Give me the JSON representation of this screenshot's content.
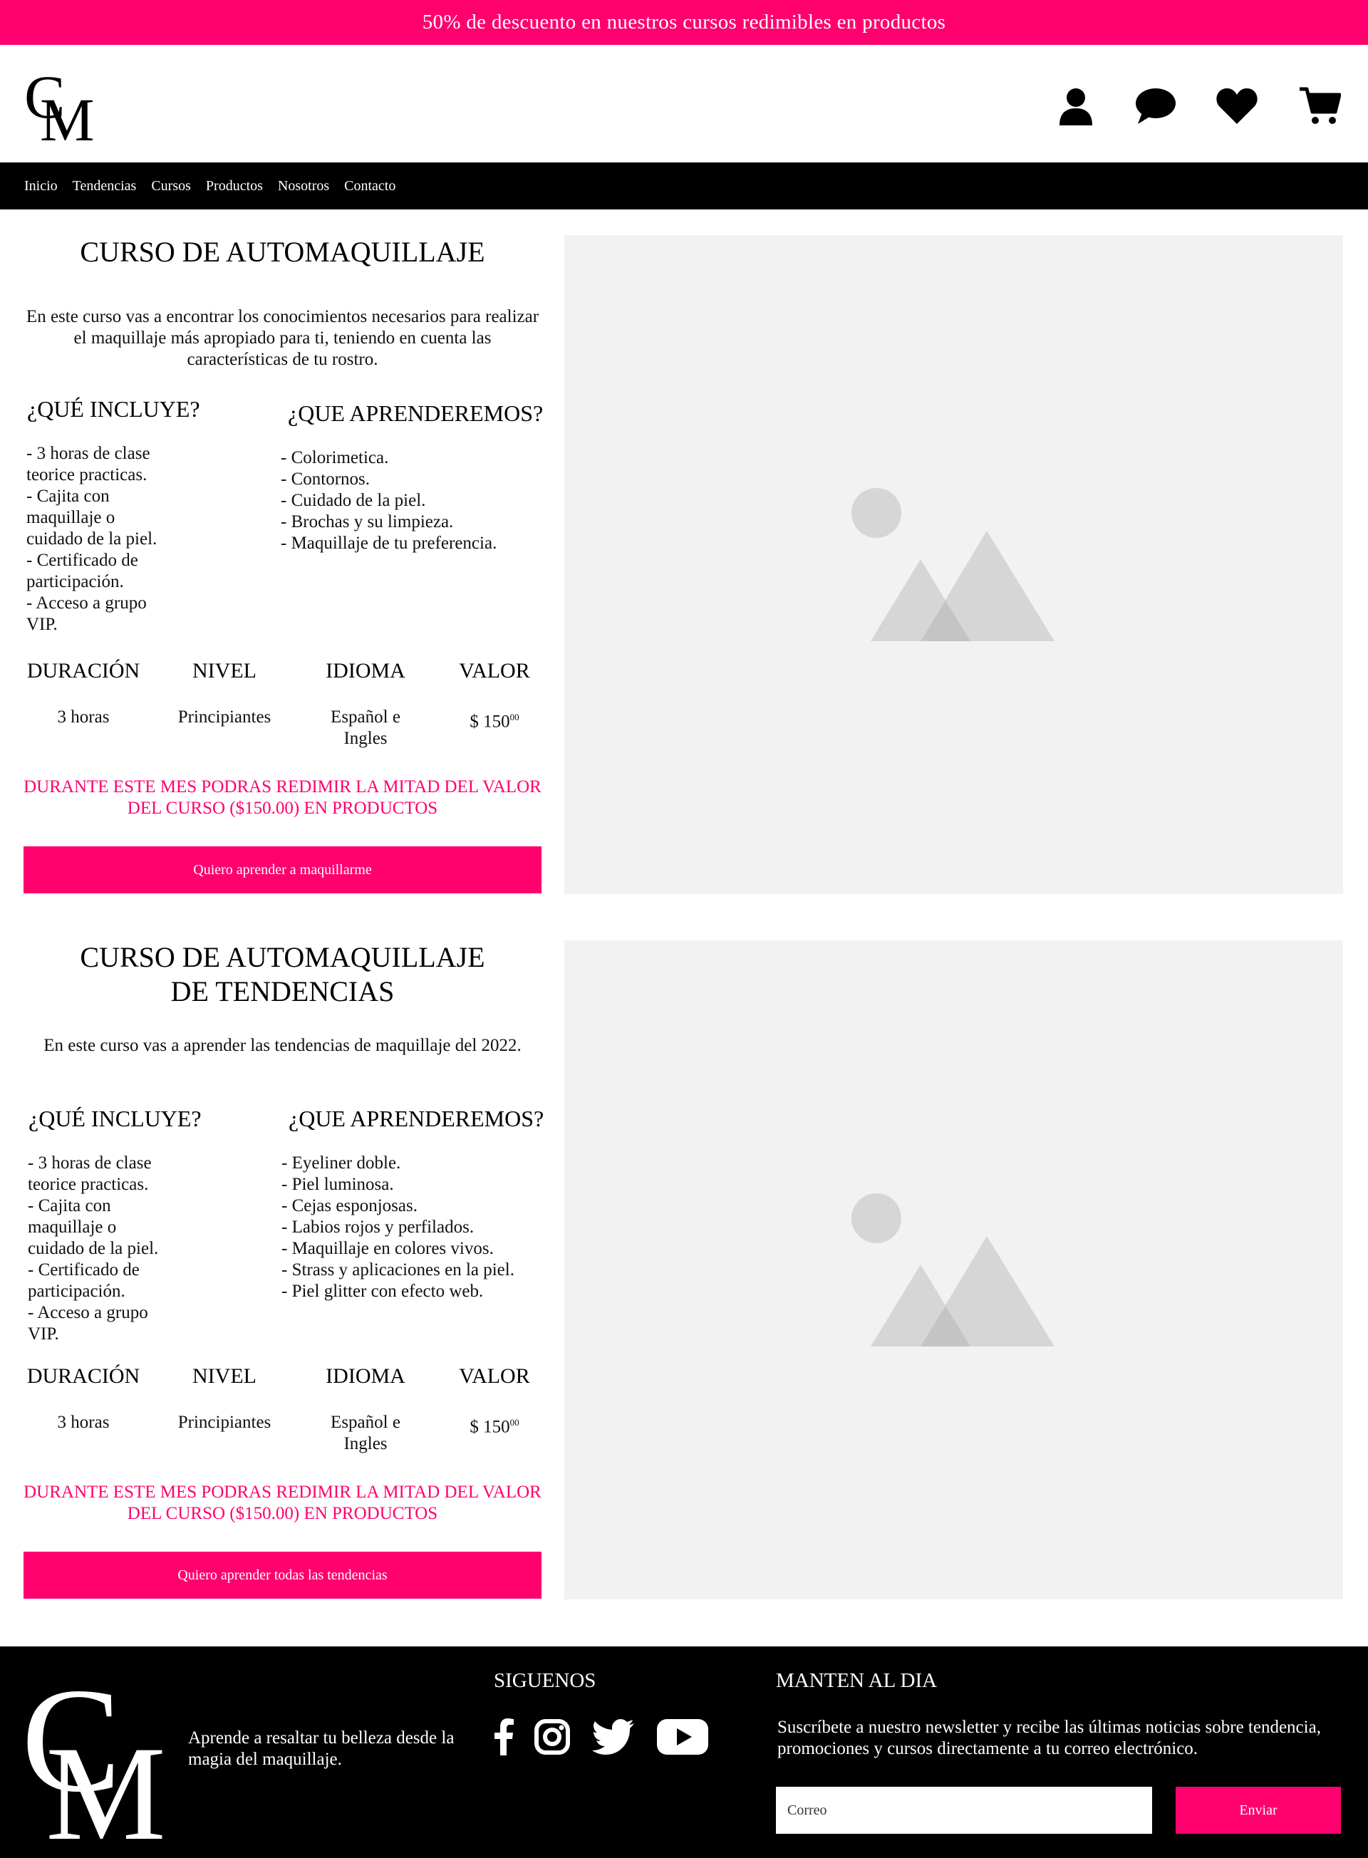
{
  "promo_bar": {
    "text": "50% de descuento en nuestros cursos redimibles en productos"
  },
  "nav": {
    "items": [
      "Inicio",
      "Tendencias",
      "Cursos",
      "Productos",
      "Nosotros",
      "Contacto"
    ]
  },
  "header_icons": [
    "user-icon",
    "chat-icon",
    "heart-icon",
    "cart-icon"
  ],
  "courses": [
    {
      "title": "CURSO DE AUTOMAQUILLAJE",
      "description": "En este curso vas a encontrar los conocimientos necesarios para realizar el maquillaje más apropiado para ti, teniendo en cuenta las características de tu rostro.",
      "includes_heading": "¿QUÉ INCLUYE?",
      "includes": [
        "- 3 horas de clase\nteorice practicas.",
        "- Cajita con\nmaquillaje o\ncuidado de la piel.",
        "- Certificado de\nparticipación.",
        "- Acceso a grupo\nVIP."
      ],
      "learn_heading": "¿QUE APRENDEREMOS?",
      "learn": [
        "- Colorimetica.",
        "- Contornos.",
        "- Cuidado de la piel.",
        "- Brochas y su limpieza.",
        "- Maquillaje de tu preferencia."
      ],
      "stats": {
        "duration_label": "DURACIÓN",
        "duration": "3 horas",
        "level_label": "NIVEL",
        "level": "Principiantes",
        "language_label": "IDIOMA",
        "language": "Español e Ingles",
        "price_label": "VALOR",
        "price": "$ 150",
        "price_cents": "00"
      },
      "promo_note": "DURANTE ESTE MES PODRAS REDIMIR LA MITAD DEL VALOR DEL CURSO ($150.00) EN PRODUCTOS",
      "cta": "Quiero aprender a maquillarme"
    },
    {
      "title": "CURSO DE AUTOMAQUILLAJE DE TENDENCIAS",
      "description": "En este curso vas a aprender las tendencias de maquillaje del 2022.",
      "includes_heading": "¿QUÉ INCLUYE?",
      "includes": [
        "- 3 horas de clase\nteorice practicas.",
        "- Cajita con\nmaquillaje o\ncuidado de la piel.",
        "- Certificado de\nparticipación.",
        "- Acceso a grupo\nVIP."
      ],
      "learn_heading": "¿QUE APRENDEREMOS?",
      "learn": [
        "- Eyeliner doble.",
        "- Piel luminosa.",
        "- Cejas esponjosas.",
        "- Labios rojos y perfilados.",
        "- Maquillaje en colores vivos.",
        "- Strass y aplicaciones en la piel.",
        "- Piel glitter con efecto web."
      ],
      "stats": {
        "duration_label": "DURACIÓN",
        "duration": "3 horas",
        "level_label": "NIVEL",
        "level": "Principiantes",
        "language_label": "IDIOMA",
        "language": "Español e Ingles",
        "price_label": "VALOR",
        "price": "$ 150",
        "price_cents": "00"
      },
      "promo_note": "DURANTE ESTE MES PODRAS REDIMIR LA MITAD DEL VALOR DEL CURSO ($150.00) EN PRODUCTOS",
      "cta": "Quiero aprender todas las tendencias"
    }
  ],
  "footer": {
    "tagline": "Aprende a resaltar tu belleza desde la magia del maquillaje.",
    "social_heading": "SIGUENOS",
    "social_icons": [
      "facebook-icon",
      "instagram-icon",
      "twitter-icon",
      "youtube-icon"
    ],
    "newsletter_heading": "MANTEN AL DIA",
    "newsletter_text": "Suscríbete a nuestro newsletter y recibe las últimas noticias sobre tendencia, promociones y cursos directamente a tu correo electrónico.",
    "email_placeholder": "Correo",
    "send_label": "Enviar"
  },
  "colors": {
    "accent": "#ff006e",
    "black": "#000000",
    "placeholder_bg": "#f2f2f2"
  }
}
